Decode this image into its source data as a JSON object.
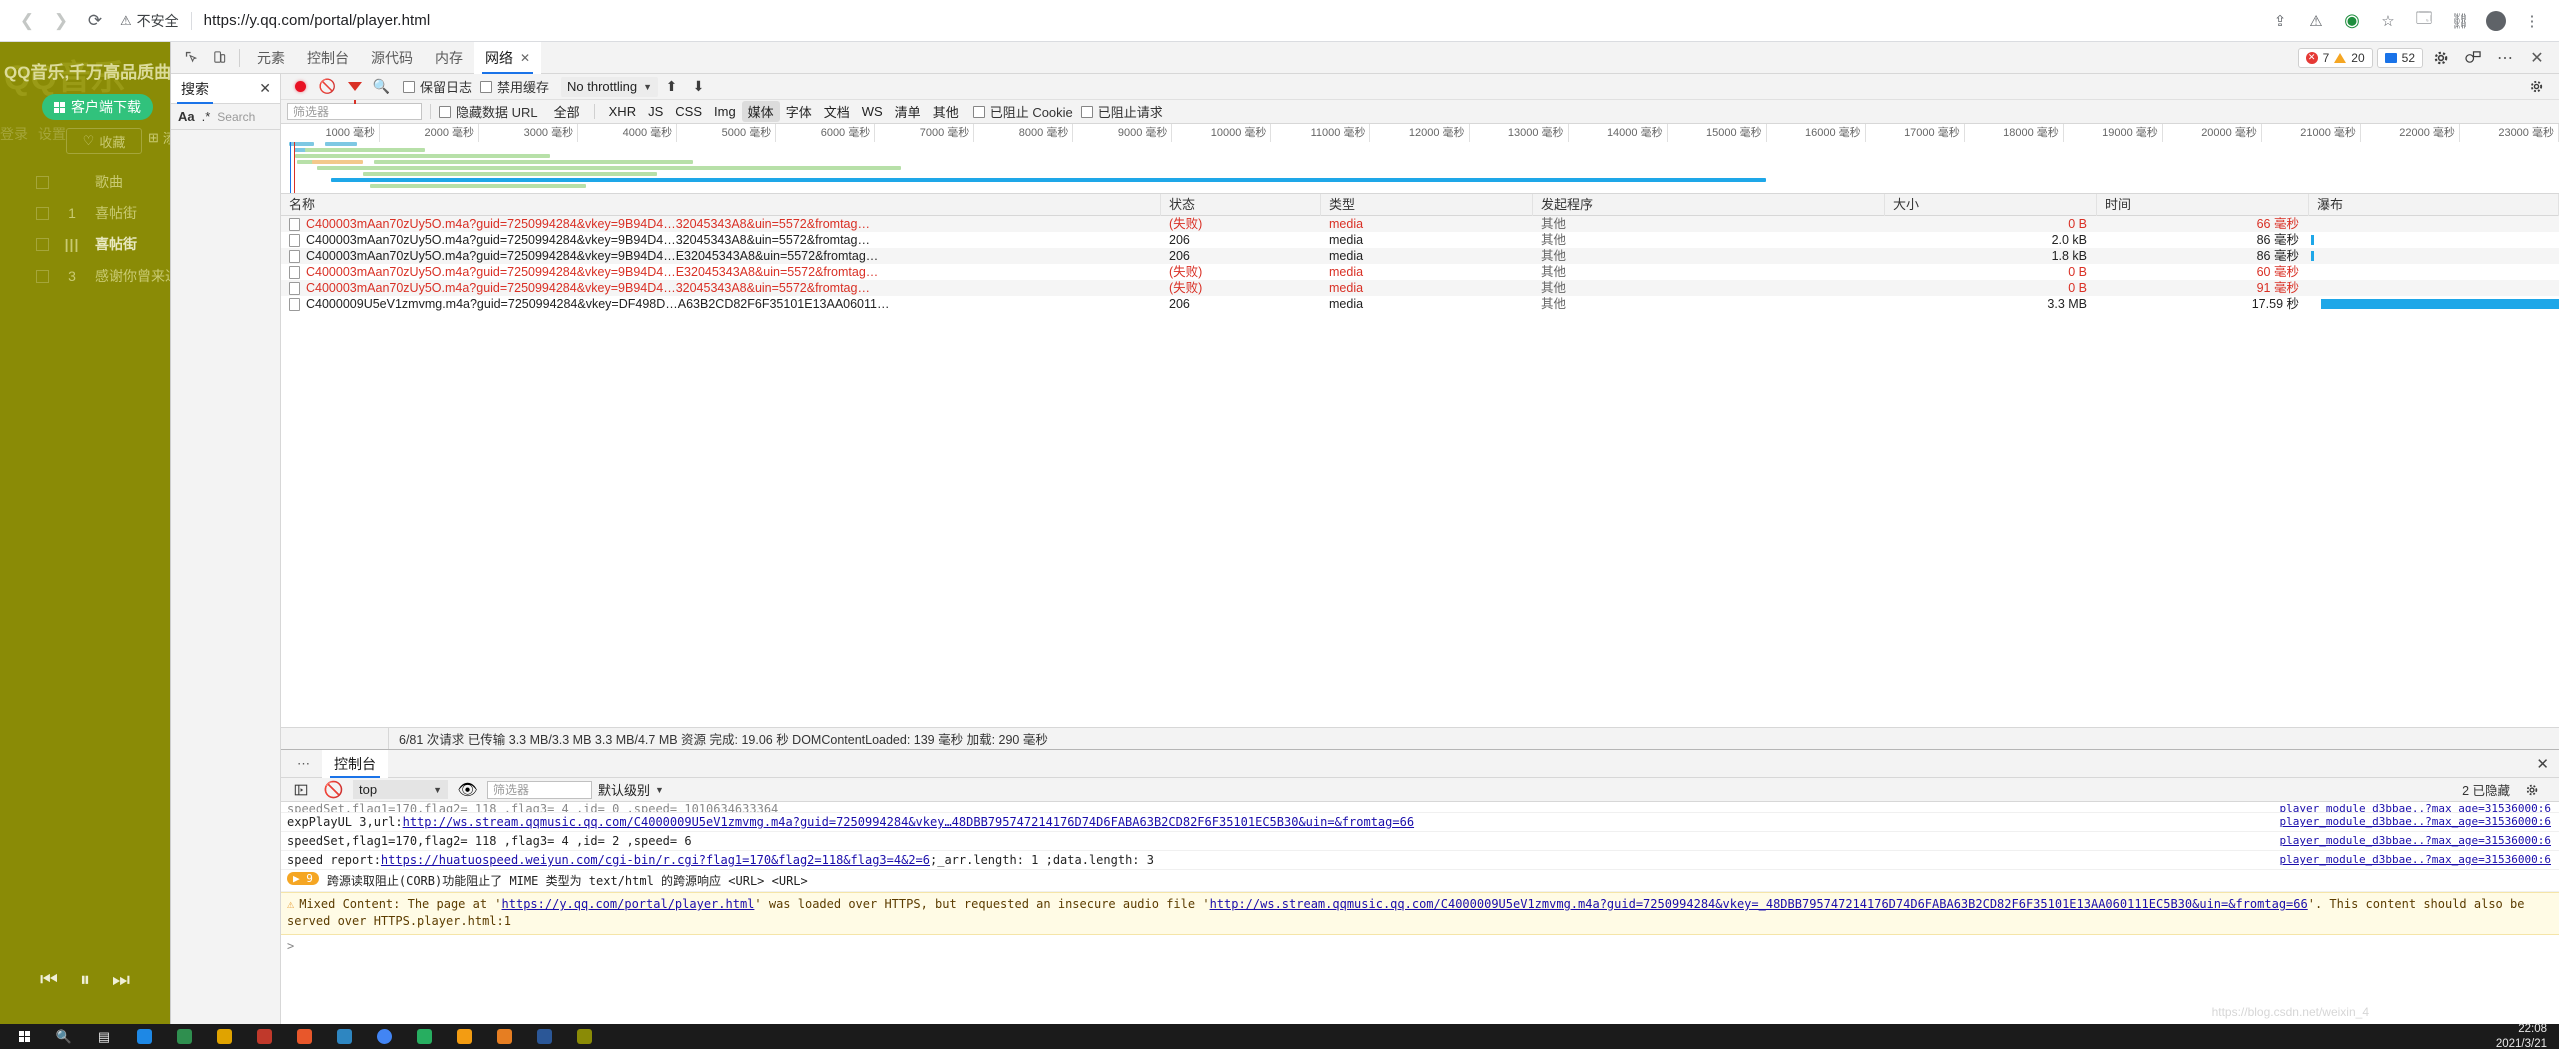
{
  "browser": {
    "back_icon": "back-arrow",
    "forward_icon": "forward-arrow",
    "reload_icon": "reload",
    "security_label": "不安全",
    "url": "https://y.qq.com/portal/player.html",
    "url_prefix": "https://",
    "url_host": "y.qq.com",
    "url_path": "/portal/player.html"
  },
  "page": {
    "ghost_logo": "QQ音乐",
    "headline": "QQ音乐,千万高品质曲库尽享",
    "client_download": "客户端下载",
    "login": "登录",
    "settings": "设置",
    "favorite": "收藏",
    "add": "添加",
    "songs": [
      {
        "num": "",
        "title": "歌曲",
        "playing": false
      },
      {
        "num": "1",
        "title": "喜帖街",
        "playing": false
      },
      {
        "num": "",
        "title": "喜帖街",
        "playing": true
      },
      {
        "num": "3",
        "title": "感谢你曾来过",
        "playing": false
      }
    ]
  },
  "devtools": {
    "inspect_icon": "inspect-element",
    "device_icon": "device-toolbar",
    "tabs": [
      {
        "label": "元素",
        "active": false
      },
      {
        "label": "控制台",
        "active": false
      },
      {
        "label": "源代码",
        "active": false
      },
      {
        "label": "内存",
        "active": false
      },
      {
        "label": "网络",
        "active": true,
        "closable": true
      }
    ],
    "counters": {
      "errors": "7",
      "warnings": "20",
      "messages": "52"
    },
    "settings_icon": "gear-icon",
    "dock_icon": "customize-dock-icon",
    "more_icon": "more-options",
    "close_icon": "close-devtools"
  },
  "search_pane": {
    "tab_label": "搜索",
    "close_label": "✕",
    "match_case": "Aa",
    "regex": ".*",
    "placeholder": "Search"
  },
  "network_toolbar": {
    "record_icon": "record-button",
    "clear_icon": "clear-button",
    "filter_icon": "filter-button",
    "search_icon": "search-button",
    "preserve_log": "保留日志",
    "disable_cache": "禁用缓存",
    "throttling": "No throttling",
    "import_icon": "import-har",
    "export_icon": "export-har",
    "settings_icon": "network-settings"
  },
  "filter_row": {
    "placeholder": "筛选器",
    "hide_data_urls": "隐藏数据 URL",
    "types": [
      {
        "label": "全部",
        "active": false
      },
      {
        "label": "XHR",
        "active": false
      },
      {
        "label": "JS",
        "active": false
      },
      {
        "label": "CSS",
        "active": false
      },
      {
        "label": "Img",
        "active": false
      },
      {
        "label": "媒体",
        "active": true
      },
      {
        "label": "字体",
        "active": false
      },
      {
        "label": "文档",
        "active": false
      },
      {
        "label": "WS",
        "active": false
      },
      {
        "label": "清单",
        "active": false
      },
      {
        "label": "其他",
        "active": false
      }
    ],
    "blocked_cookies": "已阻止 Cookie",
    "blocked_requests": "已阻止请求"
  },
  "timeline": {
    "unit": "毫秒",
    "ticks": [
      "1000 毫秒",
      "2000 毫秒",
      "3000 毫秒",
      "4000 毫秒",
      "5000 毫秒",
      "6000 毫秒",
      "7000 毫秒",
      "8000 毫秒",
      "9000 毫秒",
      "10000 毫秒",
      "11000 毫秒",
      "12000 毫秒",
      "13000 毫秒",
      "14000 毫秒",
      "15000 毫秒",
      "16000 毫秒",
      "17000 毫秒",
      "18000 毫秒",
      "19000 毫秒",
      "20000 毫秒",
      "21000 毫秒",
      "22000 毫秒",
      "23000 毫秒"
    ]
  },
  "table": {
    "headers": [
      "名称",
      "状态",
      "类型",
      "发起程序",
      "大小",
      "时间",
      "瀑布"
    ],
    "rows": [
      {
        "name": "C400003mAan70zUy5O.m4a?guid=7250994284&vkey=9B94D4…32045343A8&uin=5572&fromtag…",
        "status": "(失败)",
        "type": "media",
        "initiator": "其他",
        "size": "0 B",
        "time": "66 毫秒",
        "error": true
      },
      {
        "name": "C400003mAan70zUy5O.m4a?guid=7250994284&vkey=9B94D4…32045343A8&uin=5572&fromtag…",
        "status": "206",
        "type": "media",
        "initiator": "其他",
        "size": "2.0 kB",
        "time": "86 毫秒",
        "error": false
      },
      {
        "name": "C400003mAan70zUy5O.m4a?guid=7250994284&vkey=9B94D4…E32045343A8&uin=5572&fromtag…",
        "status": "206",
        "type": "media",
        "initiator": "其他",
        "size": "1.8 kB",
        "time": "86 毫秒",
        "error": false
      },
      {
        "name": "C400003mAan70zUy5O.m4a?guid=7250994284&vkey=9B94D4…E32045343A8&uin=5572&fromtag…",
        "status": "(失败)",
        "type": "media",
        "initiator": "其他",
        "size": "0 B",
        "time": "60 毫秒",
        "error": true
      },
      {
        "name": "C400003mAan70zUy5O.m4a?guid=7250994284&vkey=9B94D4…32045343A8&uin=5572&fromtag…",
        "status": "(失败)",
        "type": "media",
        "initiator": "其他",
        "size": "0 B",
        "time": "91 毫秒",
        "error": true
      },
      {
        "name": "C4000009U5eV1zmvmg.m4a?guid=7250994284&vkey=DF498D…A63B2CD82F6F35101E13AA06011…",
        "status": "206",
        "type": "media",
        "initiator": "其他",
        "size": "3.3 MB",
        "time": "17.59 秒",
        "error": false
      }
    ]
  },
  "net_status": "6/81 次请求  已传输 3.3 MB/3.3 MB  3.3 MB/4.7 MB 资源  完成: 19.06 秒  DOMContentLoaded: 139 毫秒  加载: 290 毫秒",
  "drawer": {
    "more_dots": "⋯",
    "tab_label": "控制台",
    "close_icon": "close-drawer",
    "sidebar_icon": "console-sidebar",
    "clear_icon": "clear-console",
    "context": "top",
    "eye_icon": "live-expression-eye",
    "filter_placeholder": "筛选器",
    "level": "默认级别",
    "hidden_count": "2 已隐藏",
    "settings_icon": "console-settings"
  },
  "console": {
    "lines": [
      {
        "kind": "clipped",
        "text": "speedSet,flag1=170,flag2=  118 ,flag3= 4  ,id=   0  ,speed= 1010634633364",
        "source": "player_module_d3bbae..?max_age=31536000:6"
      },
      {
        "kind": "link",
        "prefix": "expPlayUL 3,url:  ",
        "link": "http://ws.stream.qqmusic.qq.com/C4000009U5eV1zmvmg.m4a?guid=7250994284&vkey…48DBB795747214176D74D6FABA63B2CD82F6F35101EC5B30&uin=&fromtag=66",
        "source": "player_module_d3bbae..?max_age=31536000:6"
      },
      {
        "kind": "plain",
        "text": "speedSet,flag1=170,flag2=  118 ,flag3= 4  ,id=   2  ,speed= 6",
        "source": "player_module_d3bbae..?max_age=31536000:6"
      },
      {
        "kind": "link2",
        "prefix": "speed report:  ",
        "link": "https://huatuospeed.weiyun.com/cgi-bin/r.cgi?flag1=170&flag2=118&flag3=4&2=6",
        "suffix": "  ;_arr.length:   1   ;data.length:   3",
        "source": "player_module_d3bbae..?max_age=31536000:6"
      },
      {
        "kind": "group",
        "badge": "9",
        "text": "跨源读取阻止(CORB)功能阻止了 MIME 类型为 text/html 的跨源响应 <URL> <URL>"
      },
      {
        "kind": "warning",
        "prefix": "Mixed Content: The page at '",
        "link1": "https://y.qq.com/portal/player.html",
        "mid": "' was loaded over HTTPS, but requested an insecure audio file '",
        "link2": "http://ws.stream.qqmusic.qq.com/C4000009U5eV1zmvmg.m4a?guid=7250994284&vkey=_48DBB795747214176D74D6FABA63B2CD82F6F35101E13AA06011",
        "link3": "1EC5B30&uin=&fromtag=66",
        "suffix": "'. This content should also be served over HTTPS.",
        "source": "player.html:1"
      }
    ],
    "prompt": ">"
  },
  "player": {
    "prev_icon": "previous-track",
    "pause_icon": "pause",
    "next_icon": "next-track"
  },
  "taskbar": {
    "start_icon": "windows-start",
    "search_icon": "taskbar-search",
    "task_view_icon": "task-view",
    "clock_time": "22:08",
    "clock_date": "2021/3/21",
    "watermark": "https://blog.csdn.net/weixin_4"
  },
  "colors": {
    "accent": "#1a73e8",
    "error": "#d93025",
    "record": "#e81123",
    "waterfall_bar": "#1ea7e8",
    "page_bg": "#8a8b06",
    "green_button": "#31c27c"
  }
}
